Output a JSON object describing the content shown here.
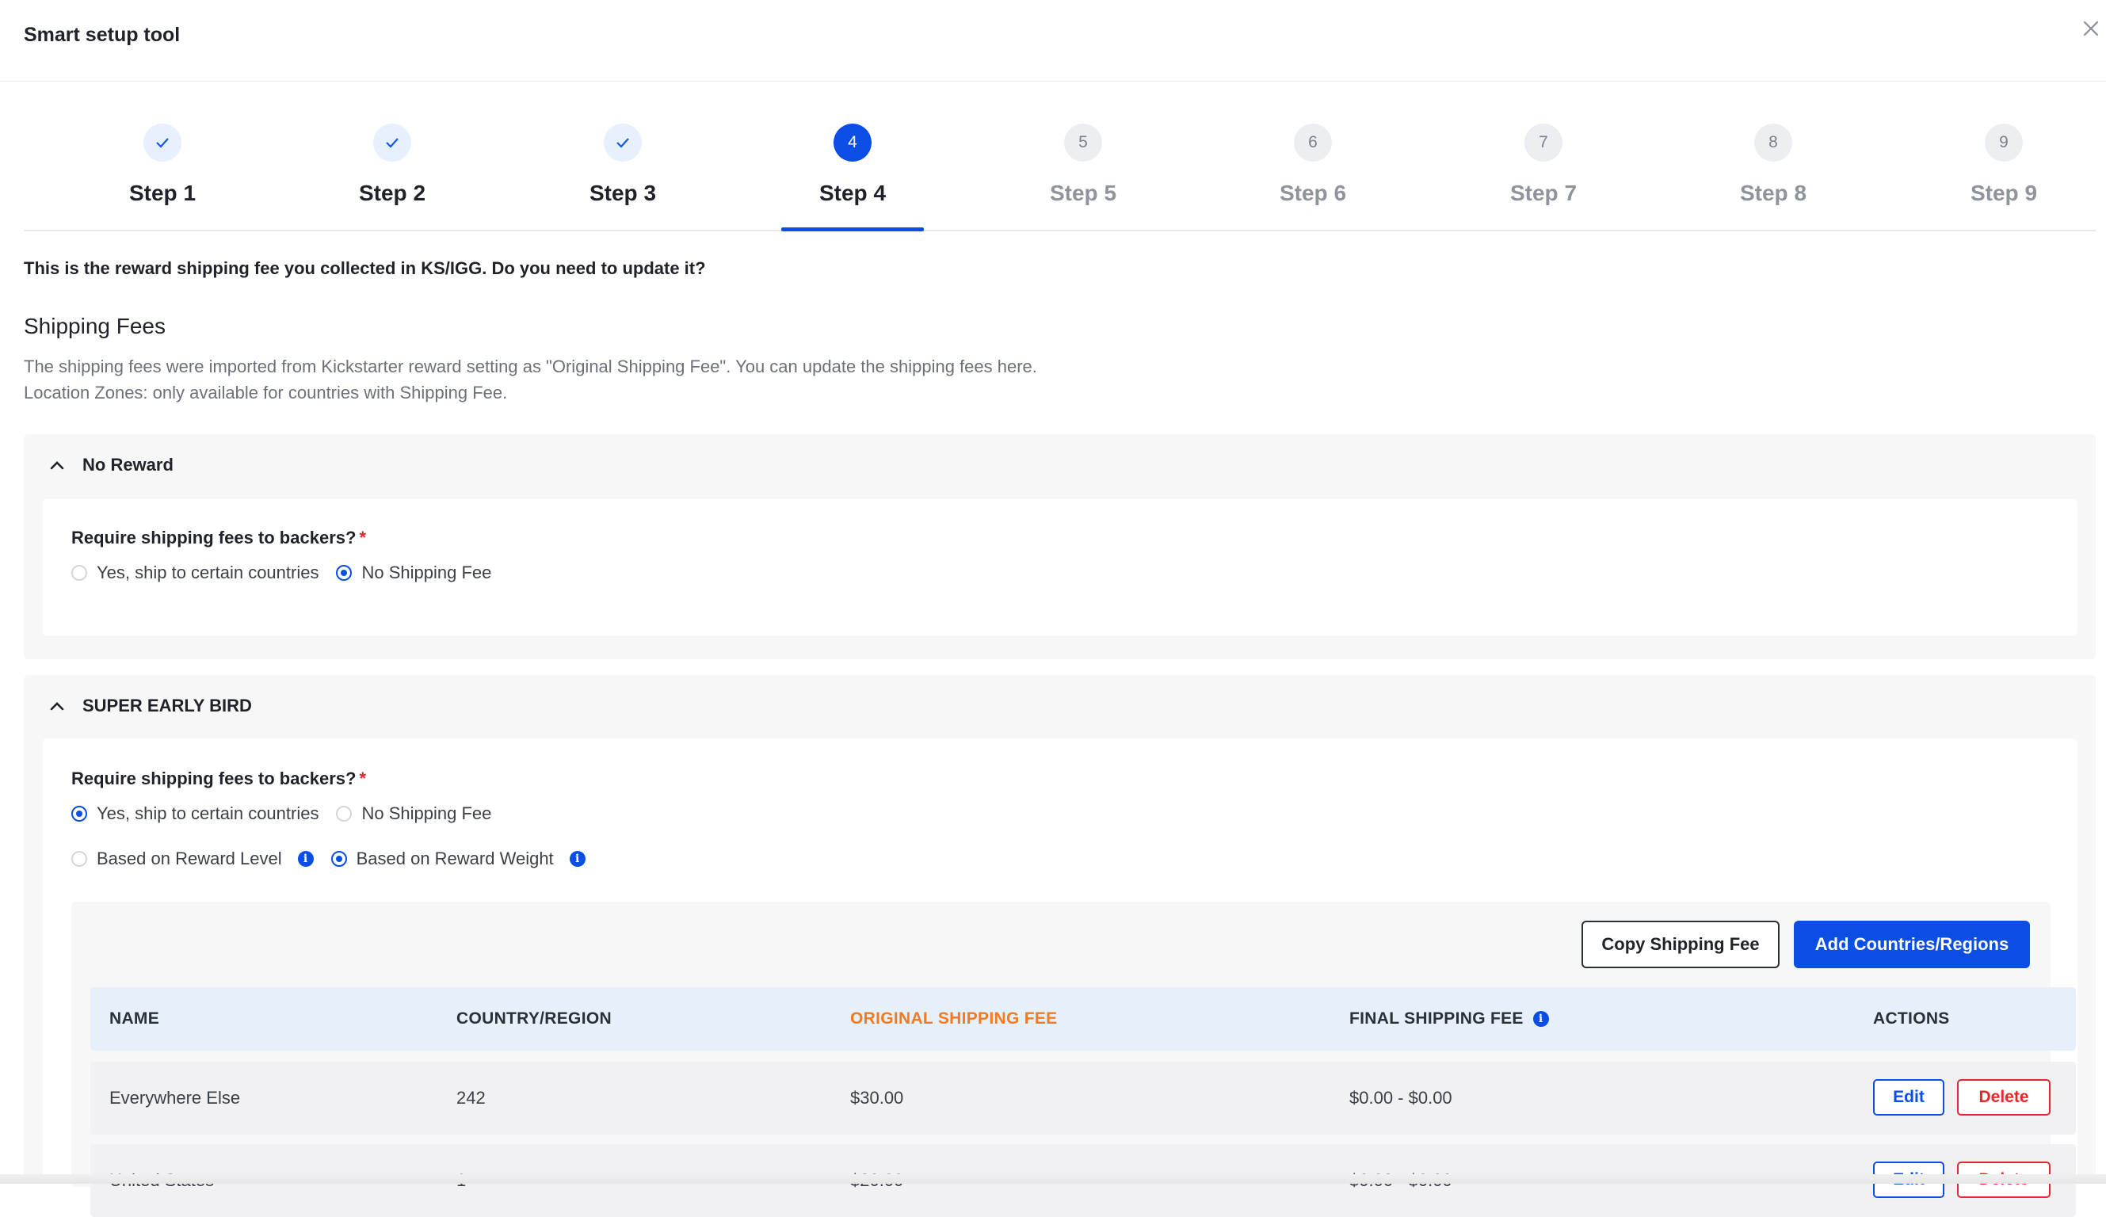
{
  "header": {
    "title": "Smart setup tool",
    "close_icon": "close-icon"
  },
  "steps": [
    {
      "number": "1",
      "label": "Step 1",
      "state": "done"
    },
    {
      "number": "2",
      "label": "Step 2",
      "state": "done"
    },
    {
      "number": "3",
      "label": "Step 3",
      "state": "done"
    },
    {
      "number": "4",
      "label": "Step 4",
      "state": "active"
    },
    {
      "number": "5",
      "label": "Step 5",
      "state": "todo"
    },
    {
      "number": "6",
      "label": "Step 6",
      "state": "todo"
    },
    {
      "number": "7",
      "label": "Step 7",
      "state": "todo"
    },
    {
      "number": "8",
      "label": "Step 8",
      "state": "todo"
    },
    {
      "number": "9",
      "label": "Step 9",
      "state": "todo"
    }
  ],
  "main": {
    "question": "This is the reward shipping fee you collected in KS/IGG. Do you need to update it?",
    "section_title": "Shipping Fees",
    "desc_line1": "The shipping fees were imported from Kickstarter reward setting as \"Original Shipping Fee\". You can update the shipping fees here.",
    "desc_line2": "Location Zones: only available for countries with Shipping Fee."
  },
  "rewards": [
    {
      "title": "No Reward",
      "require_label": "Require shipping fees to backers?",
      "required_mark": "*",
      "option_yes": "Yes, ship to certain countries",
      "option_no": "No Shipping Fee",
      "selected": "no"
    },
    {
      "title": "SUPER EARLY BIRD",
      "require_label": "Require shipping fees to backers?",
      "required_mark": "*",
      "option_yes": "Yes, ship to certain countries",
      "option_no": "No Shipping Fee",
      "selected": "yes",
      "basis_level": "Based on Reward Level",
      "basis_weight": "Based on Reward Weight",
      "basis_selected": "weight",
      "copy_button": "Copy Shipping Fee",
      "add_button": "Add Countries/Regions",
      "columns": [
        "NAME",
        "COUNTRY/REGION",
        "ORIGINAL SHIPPING FEE",
        "FINAL SHIPPING FEE",
        "ACTIONS"
      ],
      "rows": [
        {
          "name": "Everywhere Else",
          "country": "242",
          "original": "$30.00",
          "final": "$0.00 - $0.00",
          "edit": "Edit",
          "delete": "Delete"
        },
        {
          "name": "United States",
          "country": "1",
          "original": "$20.00",
          "final": "$0.00 - $0.00",
          "edit": "Edit",
          "delete": "Delete"
        }
      ]
    }
  ],
  "colors": {
    "accent": "#0a4ee6",
    "orange": "#f47a1f",
    "danger": "#e8262b"
  }
}
